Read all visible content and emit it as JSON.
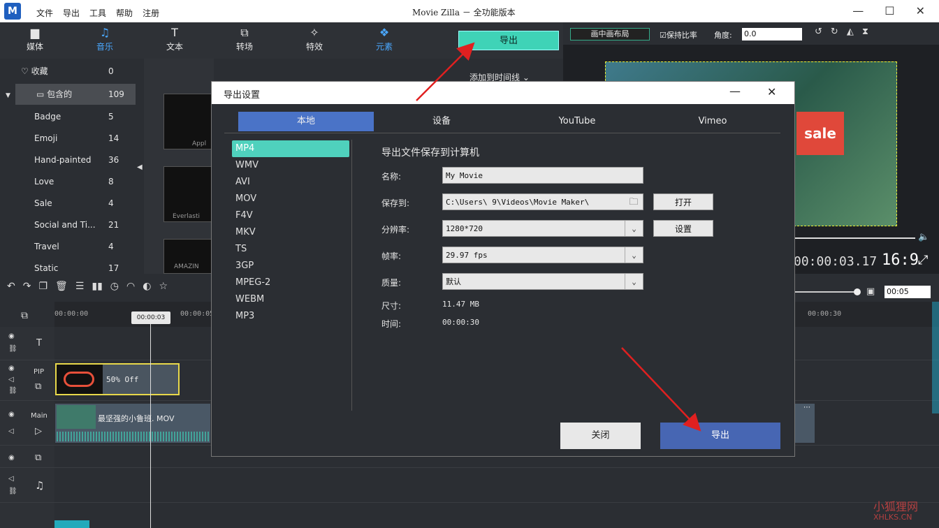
{
  "app": {
    "title": "Movie Zilla  － 全功能版本",
    "menu": [
      "文件",
      "导出",
      "工具",
      "帮助",
      "注册"
    ],
    "window_buttons": [
      "—",
      "☐",
      "✕"
    ]
  },
  "toolbar": {
    "items": [
      {
        "label": "媒体",
        "icon": "folder-icon",
        "glyph": "▆"
      },
      {
        "label": "音乐",
        "icon": "music-note-icon",
        "glyph": "♫",
        "active": true
      },
      {
        "label": "文本",
        "icon": "text-icon",
        "glyph": "T"
      },
      {
        "label": "转场",
        "icon": "transition-icon",
        "glyph": "⧉"
      },
      {
        "label": "特效",
        "icon": "effects-icon",
        "glyph": "✧"
      },
      {
        "label": "元素",
        "icon": "elements-icon",
        "glyph": "❖",
        "active": true
      }
    ],
    "export_label": "导出"
  },
  "sidebar": {
    "items": [
      {
        "label": "收藏",
        "count": "0",
        "icon": "♡"
      },
      {
        "label": "包含的",
        "count": "109",
        "icon": "▭"
      },
      {
        "label": "Badge",
        "count": "5"
      },
      {
        "label": "Emoji",
        "count": "14"
      },
      {
        "label": "Hand-painted",
        "count": "36"
      },
      {
        "label": "Love",
        "count": "8"
      },
      {
        "label": "Sale",
        "count": "4"
      },
      {
        "label": "Social and Ti...",
        "count": "21"
      },
      {
        "label": "Travel",
        "count": "4"
      },
      {
        "label": "Static",
        "count": "17"
      }
    ],
    "thumbs": [
      "Appl",
      "Everlasti",
      "AMAZIN"
    ],
    "add_to_timeline": "添加到时间线"
  },
  "preview": {
    "pip_layout": "画中画布局",
    "keep_ratio": "保持比率",
    "angle_label": "角度:",
    "angle_value": "0.0",
    "sale_text": "sale",
    "timecode": "00:00:03.17",
    "ratio": "16:9"
  },
  "timeline": {
    "ruler": [
      {
        "label": "00:00:00"
      },
      {
        "label": "00:00:05"
      },
      {
        "label": "00:00:30"
      }
    ],
    "playhead": "00:00:03",
    "zoom_value": "00:05",
    "tracks": {
      "text": "T",
      "pip": "PIP",
      "main": "Main"
    },
    "pip_clip": "50% Off",
    "main_clip": "最坚强的小鲁班. MOV"
  },
  "dialog": {
    "title": "导出设置",
    "tabs": [
      "本地",
      "设备",
      "YouTube",
      "Vimeo"
    ],
    "formats": [
      "MP4",
      "WMV",
      "AVI",
      "MOV",
      "F4V",
      "MKV",
      "TS",
      "3GP",
      "MPEG-2",
      "WEBM",
      "MP3"
    ],
    "heading": "导出文件保存到计算机",
    "name_label": "名称:",
    "name_value": "My Movie",
    "save_label": "保存到:",
    "save_value": "C:\\Users\\    9\\Videos\\Movie Maker\\",
    "open_button": "打开",
    "resolution_label": "分辨率:",
    "resolution_value": "1280*720",
    "settings_button": "设置",
    "framerate_label": "帧率:",
    "framerate_value": "29.97 fps",
    "quality_label": "质量:",
    "quality_value": "默认",
    "size_label": "尺寸:",
    "size_value": "11.47 MB",
    "time_label": "时间:",
    "time_value": "00:00:30",
    "close_button": "关闭",
    "export_button": "导出"
  },
  "watermark": {
    "line1": "小狐狸网",
    "line2": "XHLKS.CN"
  }
}
